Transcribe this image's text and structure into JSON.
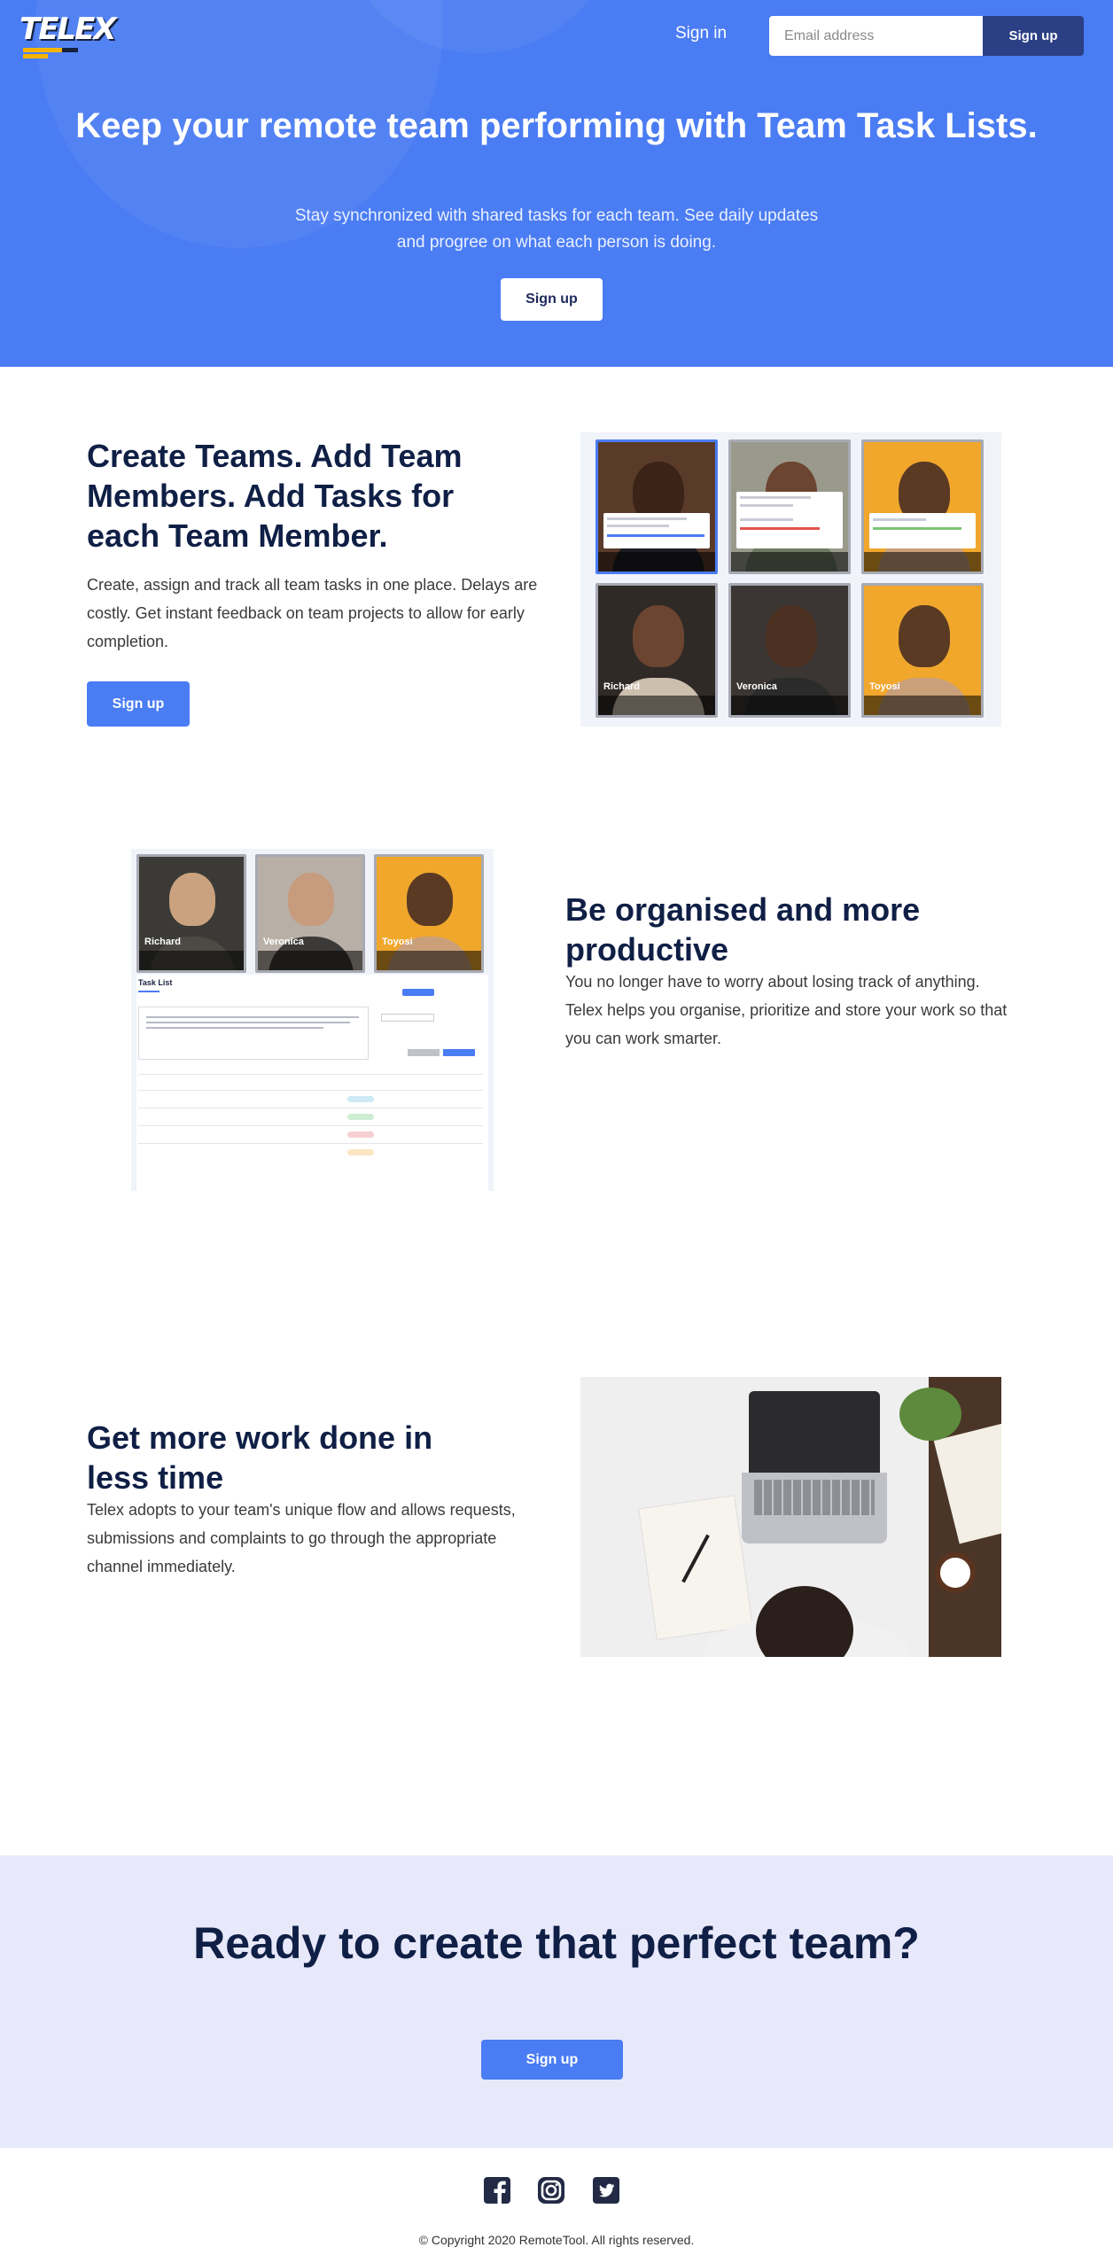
{
  "header": {
    "logo_text": "TELEX",
    "signin_label": "Sign in",
    "email_placeholder": "Email address",
    "signup_label": "Sign up"
  },
  "hero": {
    "title": "Keep your remote team performing with Team Task Lists.",
    "subtitle": "Stay synchronized with shared tasks for each team. See daily updates and progree on what each person is doing.",
    "cta_label": "Sign up"
  },
  "features": [
    {
      "title": "Create Teams. Add Team Members. Add Tasks for each Team Member.",
      "text": "Create, assign and track all team tasks in one place. Delays are costly. Get instant feedback on team projects to allow for early completion.",
      "cta_label": "Sign up",
      "member_names": [
        "Richard",
        "Veronica",
        "Toyosi"
      ]
    },
    {
      "title": "Be organised and more productive",
      "text": "You no longer have to worry about losing track of anything. Telex helps you organise, prioritize and store your work so that you can work smarter.",
      "member_names": [
        "Richard",
        "Veronica",
        "Toyosi"
      ],
      "tasklist_title": "Task List"
    },
    {
      "title": "Get more work done in less time",
      "text": "Telex adopts to your team's unique flow and allows requests, submissions and complaints to go through the appropriate channel immediately."
    }
  ],
  "cta": {
    "title": "Ready to create that perfect team?",
    "button_label": "Sign up"
  },
  "footer": {
    "social_icons": [
      "facebook-icon",
      "instagram-icon",
      "twitter-icon"
    ],
    "copyright": "© Copyright 2020 RemoteTool. All rights reserved."
  },
  "colors": {
    "primary": "#4a7cf3",
    "navy": "#2b3f85",
    "heading": "#0f1f45",
    "cta_bg": "#e8e8fb"
  }
}
